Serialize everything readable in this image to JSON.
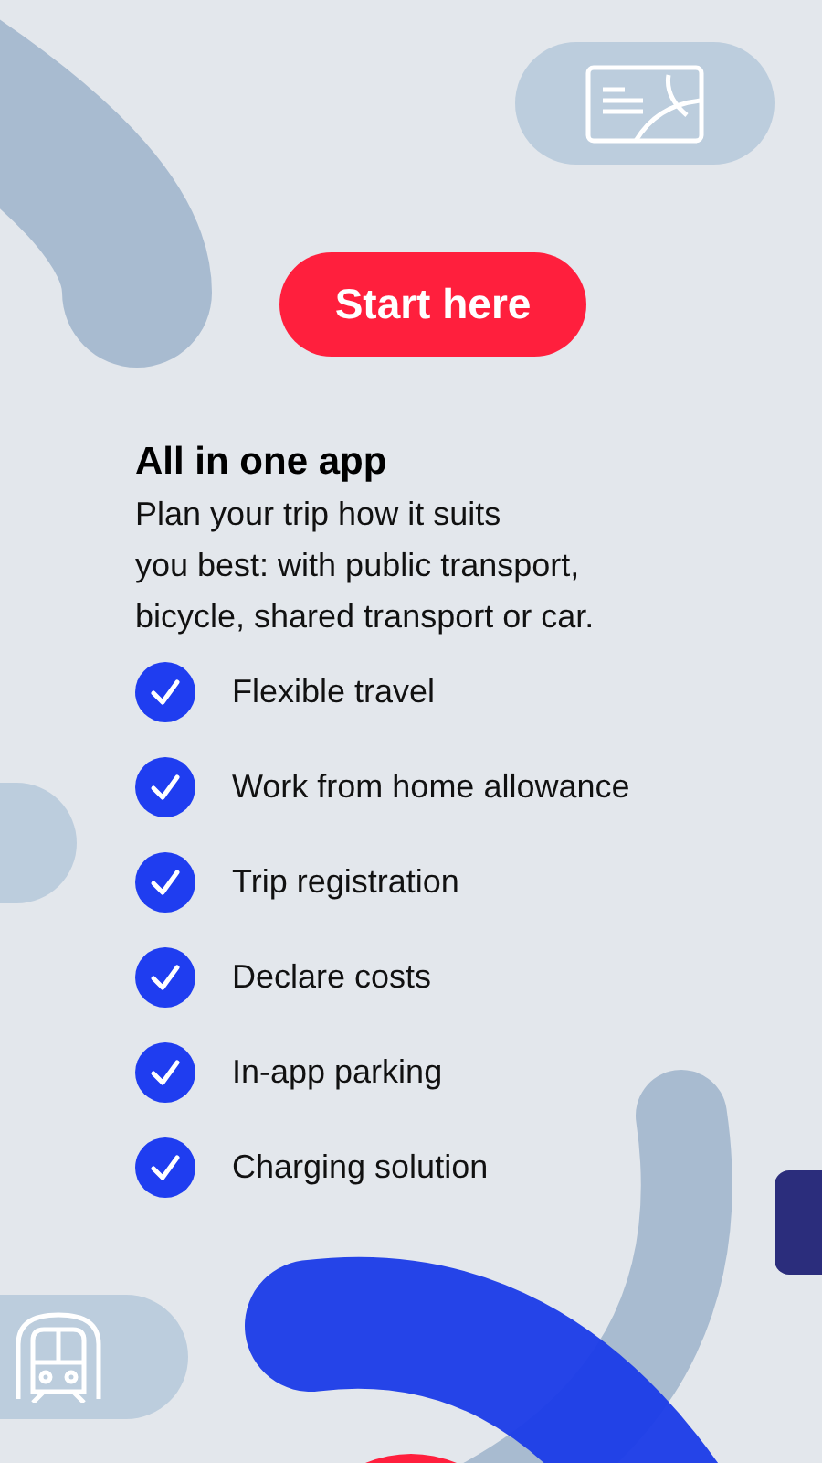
{
  "start_button": {
    "label": "Start here"
  },
  "heading": "All in one app",
  "description": "Plan your trip how it suits\nyou best: with public transport,\nbicycle, shared transport or car.",
  "features": [
    {
      "label": "Flexible travel",
      "checked": true
    },
    {
      "label": "Work from home allowance",
      "checked": true
    },
    {
      "label": "Trip registration",
      "checked": true
    },
    {
      "label": "Declare costs",
      "checked": true
    },
    {
      "label": "In-app parking",
      "checked": true
    },
    {
      "label": "Charging solution",
      "checked": true
    }
  ]
}
